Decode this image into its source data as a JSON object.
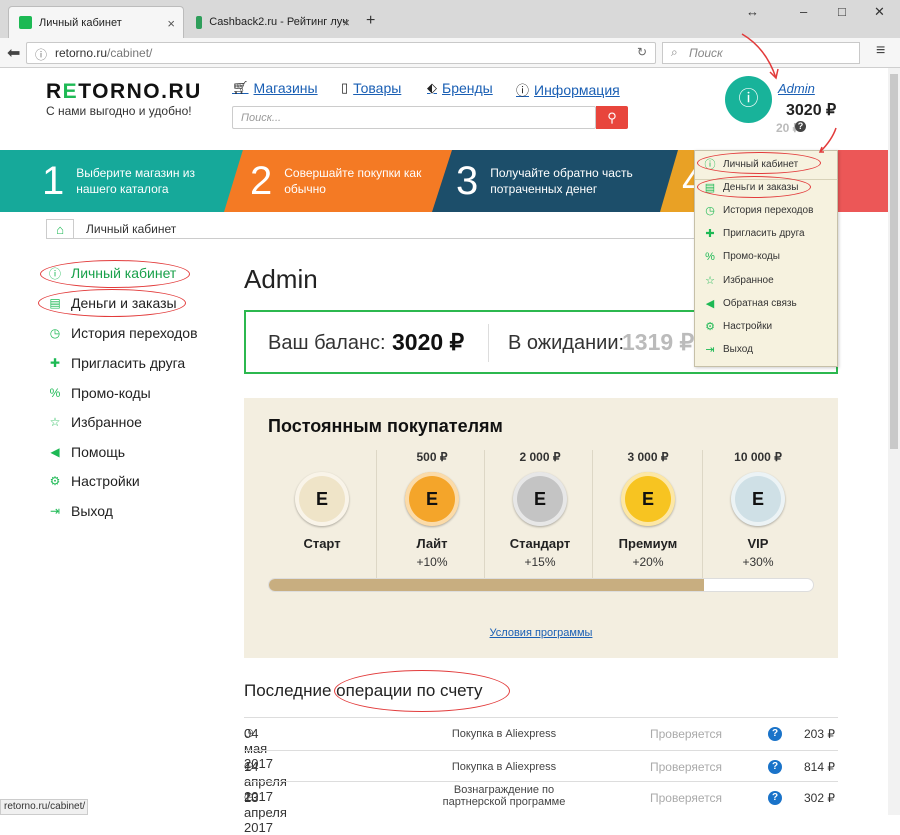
{
  "browser": {
    "tabs": [
      {
        "title": "Личный кабинет"
      },
      {
        "title": "Cashback2.ru - Рейтинг луч"
      }
    ],
    "new_tab": "+",
    "close": "×",
    "controls": {
      "restore": "↔",
      "minimize": "–",
      "maximize": "□",
      "close": "✕"
    },
    "url_host": "retorno.ru",
    "url_path": "/cabinet/",
    "search_placeholder": "Поиск",
    "status_url": "retorno.ru/cabinet/"
  },
  "site": {
    "logo_pre": "R",
    "logo_e": "E",
    "logo_post": "TORNO.RU",
    "slogan": "С нами выгодно и удобно!",
    "nav": [
      {
        "label": "Магазины",
        "icon": "cart-icon"
      },
      {
        "label": "Товары",
        "icon": "bag-icon"
      },
      {
        "label": "Бренды",
        "icon": "tag-icon"
      },
      {
        "label": "Информация",
        "icon": "info-icon"
      }
    ],
    "search_placeholder": "Поиск...",
    "user": {
      "name": "Admin",
      "balance": "3020 ₽",
      "pending": "20 ₽",
      "help": "?"
    }
  },
  "banner": {
    "steps": [
      {
        "num": "1",
        "text": "Выберите магазин из нашего каталога",
        "color": "#16a99a"
      },
      {
        "num": "2",
        "text": "Совершайте покупки как обычно",
        "color": "#f47a24"
      },
      {
        "num": "3",
        "text": "Получайте обратно часть потраченных денег",
        "color": "#1c4e6a"
      },
      {
        "num": "4",
        "text": "",
        "color": "#e9a125"
      }
    ]
  },
  "breadcrumb": {
    "current": "Личный кабинет"
  },
  "sidebar": {
    "items": [
      {
        "label": "Личный кабинет",
        "icon": "user-circle-icon"
      },
      {
        "label": "Деньги и заказы",
        "icon": "money-icon"
      },
      {
        "label": "История переходов",
        "icon": "clock-icon"
      },
      {
        "label": "Пригласить друга",
        "icon": "add-user-icon"
      },
      {
        "label": "Промо-коды",
        "icon": "percent-icon"
      },
      {
        "label": "Избранное",
        "icon": "star-icon"
      },
      {
        "label": "Помощь",
        "icon": "megaphone-icon"
      },
      {
        "label": "Настройки",
        "icon": "gear-icon"
      },
      {
        "label": "Выход",
        "icon": "exit-icon"
      }
    ]
  },
  "main": {
    "title": "Admin",
    "balance_label": "Ваш баланс:",
    "balance_value": "3020 ₽",
    "pending_label": "В ожидании:",
    "pending_value": "1319 ₽",
    "loyalty": {
      "title": "Постоянным покупателям",
      "tiers": [
        {
          "threshold": "",
          "name": "Старт",
          "percent": "",
          "color": "#efe4c8"
        },
        {
          "threshold": "500 ₽",
          "name": "Лайт",
          "percent": "+10%",
          "color": "#f4a52a"
        },
        {
          "threshold": "2 000 ₽",
          "name": "Стандарт",
          "percent": "+15%",
          "color": "#c4c4c4"
        },
        {
          "threshold": "3 000 ₽",
          "name": "Премиум",
          "percent": "+20%",
          "color": "#f7c421"
        },
        {
          "threshold": "10 000 ₽",
          "name": "VIP",
          "percent": "+30%",
          "color": "#cfe0e6"
        }
      ],
      "progress": 0.8,
      "terms": "Условия программы"
    },
    "ops_title": "Последние операции по счету",
    "operations": [
      {
        "date": "04 мая 2017",
        "desc": "Покупка в Aliexpress",
        "status": "Проверяется",
        "help": "?",
        "sum": "203 ₽"
      },
      {
        "date": "14 апреля 2017",
        "desc": "Покупка в Aliexpress",
        "status": "Проверяется",
        "help": "?",
        "sum": "814 ₽"
      },
      {
        "date": "13 апреля 2017",
        "desc": "Вознаграждение по партнерской программе",
        "status": "Проверяется",
        "help": "?",
        "sum": "302 ₽"
      }
    ]
  },
  "dropdown": {
    "items": [
      {
        "label": "Личный кабинет",
        "icon": "user-circle-icon"
      },
      {
        "label": "Деньги и заказы",
        "icon": "money-icon"
      },
      {
        "label": "История переходов",
        "icon": "clock-icon"
      },
      {
        "label": "Пригласить друга",
        "icon": "add-user-icon"
      },
      {
        "label": "Промо-коды",
        "icon": "percent-icon"
      },
      {
        "label": "Избранное",
        "icon": "star-icon"
      },
      {
        "label": "Обратная связь",
        "icon": "megaphone-icon"
      },
      {
        "label": "Настройки",
        "icon": "gear-icon"
      },
      {
        "label": "Выход",
        "icon": "exit-icon"
      }
    ]
  },
  "colors": {
    "brand_green": "#1db954",
    "accent_red": "#e8453c",
    "link": "#1a5fb4"
  }
}
